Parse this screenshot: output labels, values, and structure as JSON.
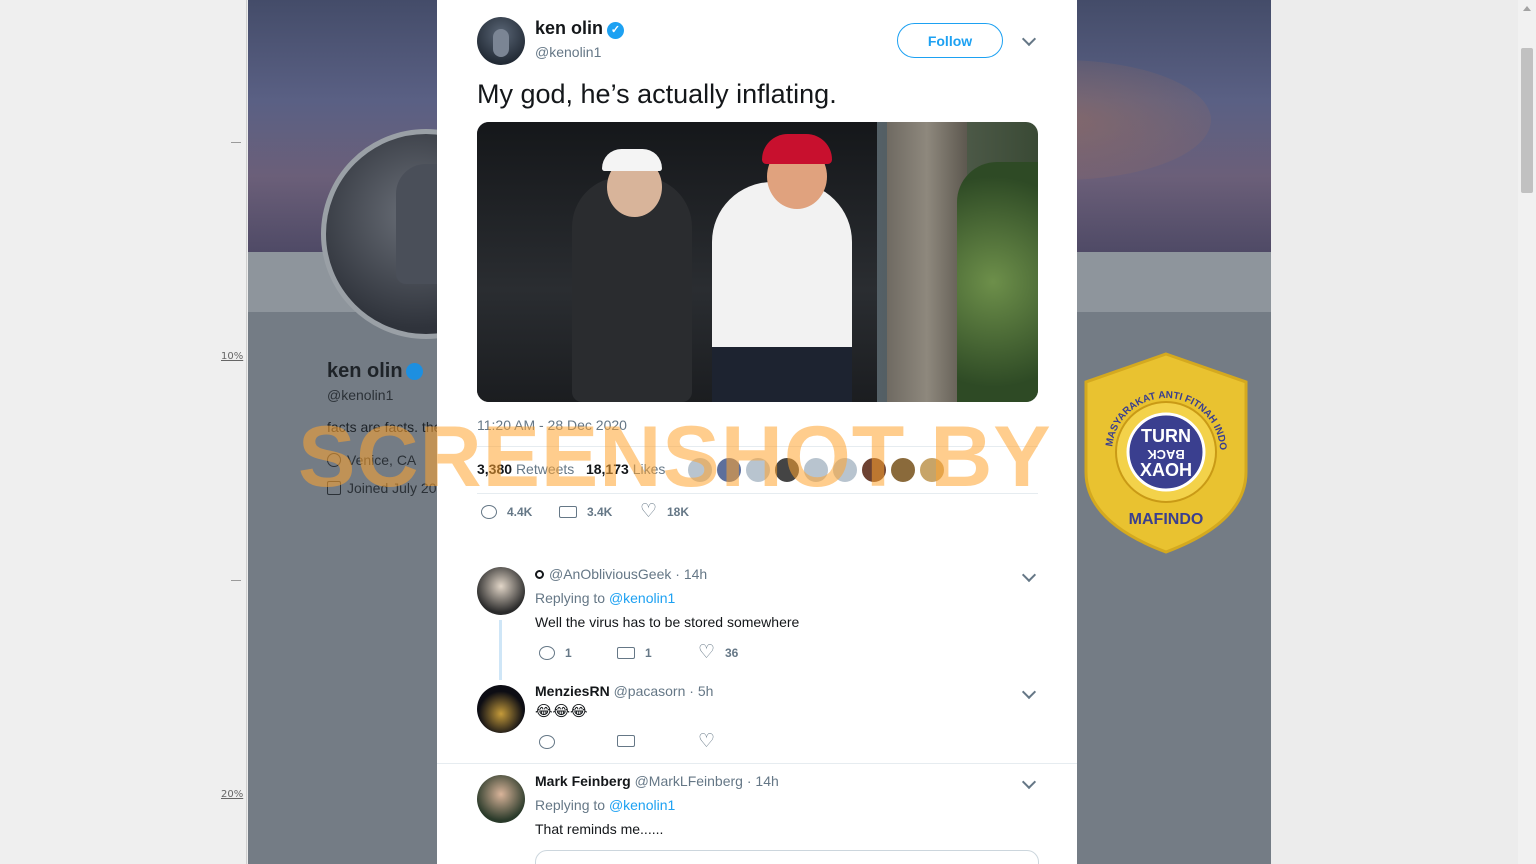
{
  "ruler": {
    "label_10": "10%",
    "label_20": "20%"
  },
  "background_profile": {
    "name": "ken olin",
    "handle": "@kenolin1",
    "bio": "facts are facts. the",
    "location": "Venice, CA",
    "joined": "Joined July 20"
  },
  "tweet": {
    "author_name": "ken olin",
    "author_handle": "@kenolin1",
    "follow_label": "Follow",
    "text": "My god, he’s actually inflating.",
    "timestamp": "11:20 AM - 28 Dec 2020",
    "retweets_count": "3,380",
    "retweets_label": "Retweets",
    "likes_count": "18,173",
    "likes_label": "Likes",
    "actions": {
      "replies": "4.4K",
      "retweets": "3.4K",
      "likes": "18K"
    }
  },
  "replies": [
    {
      "display_name": "",
      "handle": "@AnObliviousGeek",
      "time": "· 14h",
      "replying_prefix": "Replying to",
      "replying_to": "@kenolin1",
      "text": "Well the virus has to be stored somewhere",
      "actions": {
        "replies": "1",
        "retweets": "1",
        "likes": "36"
      }
    },
    {
      "display_name": "MenziesRN",
      "handle": "@pacasorn",
      "time": "· 5h",
      "text": "😂😂😂"
    },
    {
      "display_name": "Mark Feinberg",
      "handle": "@MarkLFeinberg",
      "time": "· 14h",
      "replying_prefix": "Replying to",
      "replying_to": "@kenolin1",
      "text": "That reminds me......"
    }
  ],
  "watermark": {
    "text": "SCREENSHOT BY"
  },
  "badge": {
    "ring_text": "MASYARAKAT ANTI FITNAH INDONESIA",
    "center_line1": "TURN",
    "center_line2": "BACK",
    "center_line3": "HOAX",
    "bottom_text": "MAFINDO"
  },
  "colors": {
    "accent": "#1da1f2",
    "watermark": "#ffa430",
    "badge_gold": "#e9c230",
    "badge_blue": "#3a3f8f"
  }
}
